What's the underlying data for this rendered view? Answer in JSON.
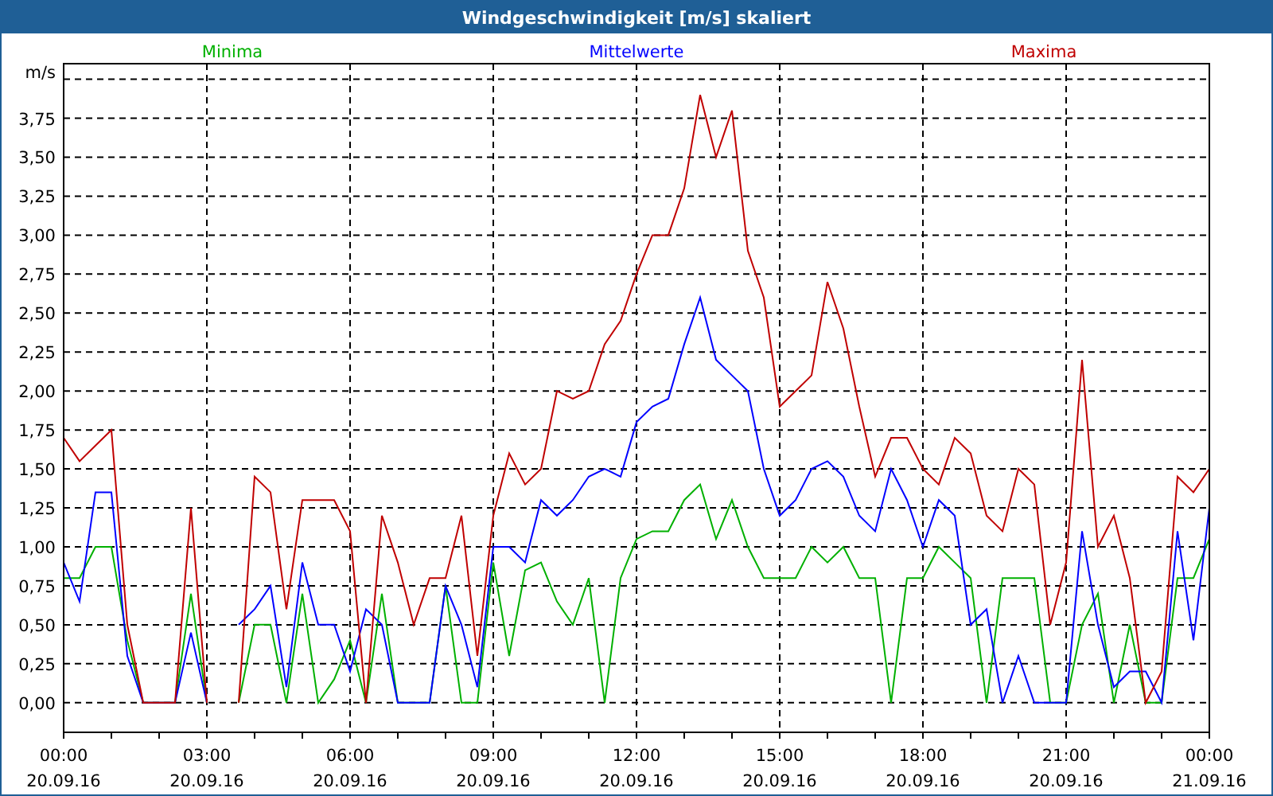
{
  "chart": {
    "chart_data": {
      "type": "line",
      "grid": true,
      "title": "Windgeschwindigkeit [m/s] skaliert",
      "ylabel": "m/s",
      "categories": [
        "00:00\n20.09.16",
        null,
        null,
        null,
        null,
        null,
        null,
        null,
        null,
        "03:00\n20.09.16",
        null,
        null,
        null,
        null,
        null,
        null,
        null,
        null,
        "06:00\n20.09.16",
        null,
        null,
        null,
        null,
        null,
        null,
        null,
        null,
        "09:00\n20.09.16",
        null,
        null,
        null,
        null,
        null,
        null,
        null,
        null,
        "12:00\n20.09.16",
        null,
        null,
        null,
        null,
        null,
        null,
        null,
        null,
        "15:00\n20.09.16",
        null,
        null,
        null,
        null,
        null,
        null,
        null,
        null,
        "18:00\n20.09.16",
        null,
        null,
        null,
        null,
        null,
        null,
        null,
        null,
        "21:00\n20.09.16",
        null,
        null,
        null,
        null,
        null,
        null,
        null,
        null,
        "00:00\n21.09.16"
      ],
      "series": [
        {
          "name": "Minima",
          "color": "#00b000",
          "values": [
            0.8,
            0.8,
            1.0,
            1.0,
            0.4,
            0,
            0,
            0,
            0.7,
            0,
            null,
            0,
            0.5,
            0.5,
            0,
            0.7,
            0,
            0.15,
            0.4,
            0,
            0.7,
            0,
            0,
            0,
            0.75,
            0,
            0,
            0.9,
            0.3,
            0.85,
            0.9,
            0.65,
            0.5,
            0.8,
            0,
            0.8,
            1.05,
            1.1,
            1.1,
            1.3,
            1.4,
            1.05,
            1.3,
            1.0,
            0.8,
            0.8,
            0.8,
            1.0,
            0.9,
            1.0,
            0.8,
            0.8,
            0,
            0.8,
            0.8,
            1.0,
            0.9,
            0.8,
            0,
            0.8,
            0.8,
            0.8,
            0,
            0,
            0.5,
            0.7,
            0,
            0.5,
            0,
            0,
            0.8,
            0.8,
            1.05
          ]
        },
        {
          "name": "Mittelwerte",
          "color": "#0000ff",
          "values": [
            0.9,
            0.65,
            1.35,
            1.35,
            0.3,
            0,
            0,
            0,
            0.45,
            0,
            null,
            0.5,
            0.6,
            0.75,
            0.1,
            0.9,
            0.5,
            0.5,
            0.2,
            0.6,
            0.5,
            0,
            0,
            0,
            0.75,
            0.5,
            0.1,
            1.0,
            1.0,
            0.9,
            1.3,
            1.2,
            1.3,
            1.45,
            1.5,
            1.45,
            1.8,
            1.9,
            1.95,
            2.3,
            2.6,
            2.2,
            2.1,
            2.0,
            1.5,
            1.2,
            1.3,
            1.5,
            1.55,
            1.45,
            1.2,
            1.1,
            1.5,
            1.3,
            1.0,
            1.3,
            1.2,
            0.5,
            0.6,
            0,
            0.3,
            0,
            0,
            0,
            1.1,
            0.5,
            0.1,
            0.2,
            0.2,
            0,
            1.1,
            0.4,
            1.25
          ]
        },
        {
          "name": "Maxima",
          "color": "#c00000",
          "values": [
            1.7,
            1.55,
            1.65,
            1.75,
            0.5,
            0,
            0,
            0,
            1.25,
            0,
            null,
            0,
            1.45,
            1.35,
            0.6,
            1.3,
            1.3,
            1.3,
            1.1,
            0,
            1.2,
            0.9,
            0.5,
            0.8,
            0.8,
            1.2,
            0.3,
            1.2,
            1.6,
            1.4,
            1.5,
            2.0,
            1.95,
            2.0,
            2.3,
            2.45,
            2.75,
            3.0,
            3.0,
            3.3,
            3.9,
            3.5,
            3.8,
            2.9,
            2.6,
            1.9,
            2.0,
            2.1,
            2.7,
            2.4,
            1.9,
            1.45,
            1.7,
            1.7,
            1.5,
            1.4,
            1.7,
            1.6,
            1.2,
            1.1,
            1.5,
            1.4,
            0.5,
            0.9,
            2.2,
            1.0,
            1.2,
            0.8,
            0,
            0.2,
            1.45,
            1.35,
            1.5
          ]
        }
      ],
      "ylim": [
        -0.19,
        4.1
      ],
      "yticks": [
        {
          "value": 0,
          "label": "0,00"
        },
        {
          "value": 0.25,
          "label": "0,25"
        },
        {
          "value": 0.5,
          "label": "0,50"
        },
        {
          "value": 0.75,
          "label": "0,75"
        },
        {
          "value": 1,
          "label": "1,00"
        },
        {
          "value": 1.25,
          "label": "1,25"
        },
        {
          "value": 1.5,
          "label": "1,50"
        },
        {
          "value": 1.75,
          "label": "1,75"
        },
        {
          "value": 2,
          "label": "2,00"
        },
        {
          "value": 2.25,
          "label": "2,25"
        },
        {
          "value": 2.5,
          "label": "2,50"
        },
        {
          "value": 2.75,
          "label": "2,75"
        },
        {
          "value": 3,
          "label": "3,00"
        },
        {
          "value": 3.25,
          "label": "3,25"
        },
        {
          "value": 3.5,
          "label": "3,50"
        },
        {
          "value": 3.75,
          "label": "3,75"
        }
      ]
    }
  }
}
